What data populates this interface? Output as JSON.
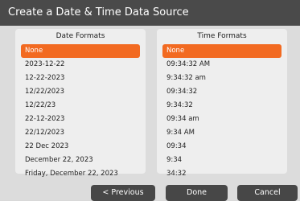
{
  "dialog": {
    "title": "Create a Date & Time Data Source"
  },
  "date_formats": {
    "header": "Date Formats",
    "selected_index": 0,
    "items": [
      "None",
      "2023-12-22",
      "12-22-2023",
      "12/22/2023",
      "12/22/23",
      "22-12-2023",
      "22/12/2023",
      "22 Dec 2023",
      "December 22, 2023",
      "Friday, December 22, 2023"
    ]
  },
  "time_formats": {
    "header": "Time Formats",
    "selected_index": 0,
    "items": [
      "None",
      "09:34:32 AM",
      "9:34:32 am",
      "09:34:32",
      "9:34:32",
      "09:34 am",
      "9:34 AM",
      "09:34",
      "9:34",
      "34:32"
    ]
  },
  "buttons": {
    "previous": "< Previous",
    "done": "Done",
    "cancel": "Cancel"
  },
  "colors": {
    "selection": "#f26a21",
    "titlebar": "#4a4a4a",
    "button": "#474747"
  }
}
